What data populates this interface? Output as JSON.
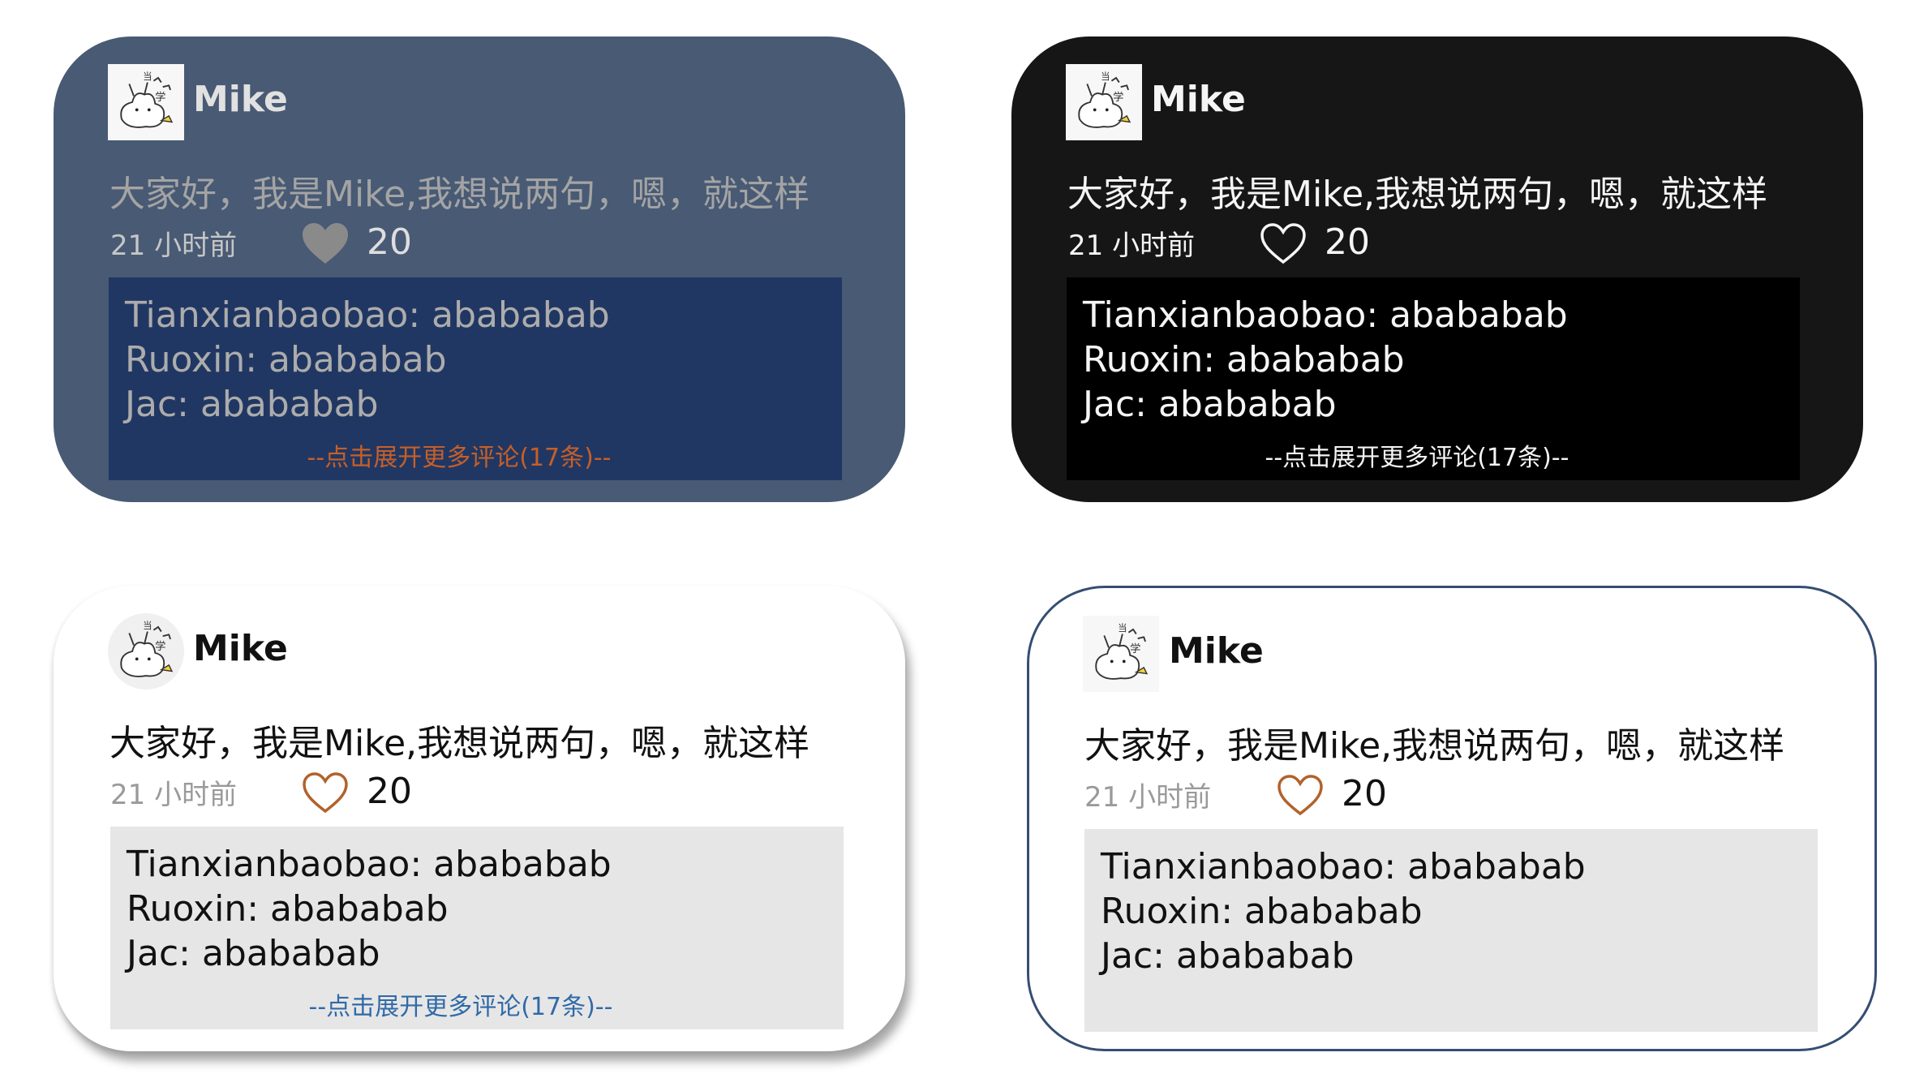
{
  "cards": [
    {
      "username": "Mike",
      "post_text": "大家好，我是Mike,我想说两句，嗯，就这样",
      "time": "21 小时前",
      "like_count": "20",
      "comments": [
        {
          "text": "Tianxianbaobao: abababab"
        },
        {
          "text": "Ruoxin: abababab"
        },
        {
          "text": "Jac: abababab"
        }
      ],
      "expand_text": "--点击展开更多评论(17条)--",
      "like_icon": "heart-filled-icon",
      "colors": {
        "card": "#485a74",
        "comments": "#213763",
        "expand": "#c65f28",
        "heart": "#8a8a8a"
      }
    },
    {
      "username": "Mike",
      "post_text": "大家好，我是Mike,我想说两句，嗯，就这样",
      "time": "21 小时前",
      "like_count": "20",
      "comments": [
        {
          "text": "Tianxianbaobao: abababab"
        },
        {
          "text": "Ruoxin: abababab"
        },
        {
          "text": "Jac: abababab"
        }
      ],
      "expand_text": "--点击展开更多评论(17条)--",
      "like_icon": "heart-outline-icon",
      "colors": {
        "card": "#161616",
        "comments": "#000000",
        "expand": "#f5f5f5",
        "heart": "#f5f5f5"
      }
    },
    {
      "username": "Mike",
      "post_text": "大家好，我是Mike,我想说两句，嗯，就这样",
      "time": "21 小时前",
      "like_count": "20",
      "comments": [
        {
          "text": "Tianxianbaobao: abababab"
        },
        {
          "text": "Ruoxin: abababab"
        },
        {
          "text": "Jac: abababab"
        }
      ],
      "expand_text": "--点击展开更多评论(17条)--",
      "like_icon": "heart-outline-icon",
      "colors": {
        "card": "#ffffff",
        "comments": "#e7e6e6",
        "expand": "#2f6aa8",
        "heart": "#b1622b"
      }
    },
    {
      "username": "Mike",
      "post_text": "大家好，我是Mike,我想说两句，嗯，就这样",
      "time": "21 小时前",
      "like_count": "20",
      "comments": [
        {
          "text": "Tianxianbaobao: abababab"
        },
        {
          "text": "Ruoxin: abababab"
        },
        {
          "text": "Jac: abababab"
        }
      ],
      "like_icon": "heart-outline-icon",
      "colors": {
        "card": "#ffffff",
        "border": "#354e72",
        "comments": "#e7e6e6",
        "heart": "#b1622b"
      }
    }
  ]
}
